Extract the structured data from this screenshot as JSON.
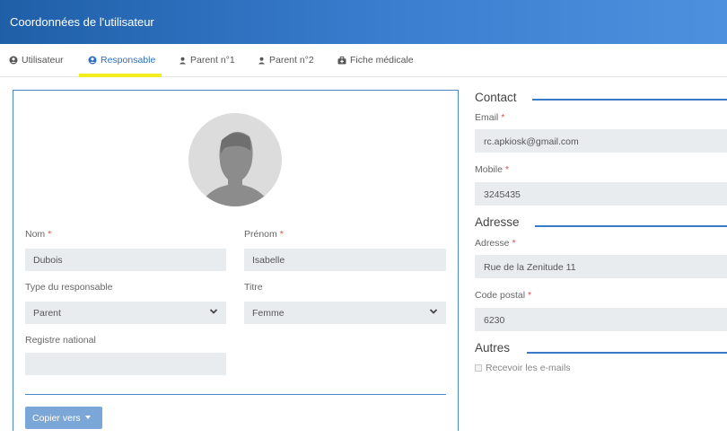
{
  "header": {
    "title": "Coordonnées de l'utilisateur"
  },
  "tabs": [
    {
      "label": "Utilisateur",
      "icon": "user-circle-icon",
      "active": false
    },
    {
      "label": "Responsable",
      "icon": "user-circle-icon",
      "active": true
    },
    {
      "label": "Parent n°1",
      "icon": "person-icon",
      "active": false
    },
    {
      "label": "Parent n°2",
      "icon": "person-icon",
      "active": false
    },
    {
      "label": "Fiche médicale",
      "icon": "medkit-icon",
      "active": false
    }
  ],
  "form": {
    "nom": {
      "label": "Nom",
      "required_mark": "*",
      "value": "Dubois"
    },
    "prenom": {
      "label": "Prénom",
      "required_mark": "*",
      "value": "Isabelle"
    },
    "type_responsable": {
      "label": "Type du responsable",
      "value": "Parent"
    },
    "titre": {
      "label": "Titre",
      "value": "Femme"
    },
    "registre_national": {
      "label": "Registre national",
      "value": ""
    },
    "copy_button": {
      "label": "Copier vers"
    }
  },
  "contact": {
    "title": "Contact",
    "email": {
      "label": "Email",
      "required_mark": "*",
      "value": "rc.apkiosk@gmail.com"
    },
    "mobile": {
      "label": "Mobile",
      "required_mark": "*",
      "value": "3245435"
    }
  },
  "adresse": {
    "title": "Adresse",
    "adresse": {
      "label": "Adresse",
      "required_mark": "*",
      "value": "Rue de la Zenitude 11"
    },
    "code_postal": {
      "label": "Code postal",
      "required_mark": "*",
      "value": "6230"
    }
  },
  "autres": {
    "title": "Autres",
    "recevoir": {
      "label": "Recevoir les e-mails",
      "checked": false
    }
  },
  "colors": {
    "header": "#2f6fbf",
    "accent": "#3a7bc8",
    "highlight": "#f5ee1f",
    "field_bg": "#e9ecef",
    "required": "#d9534f"
  }
}
